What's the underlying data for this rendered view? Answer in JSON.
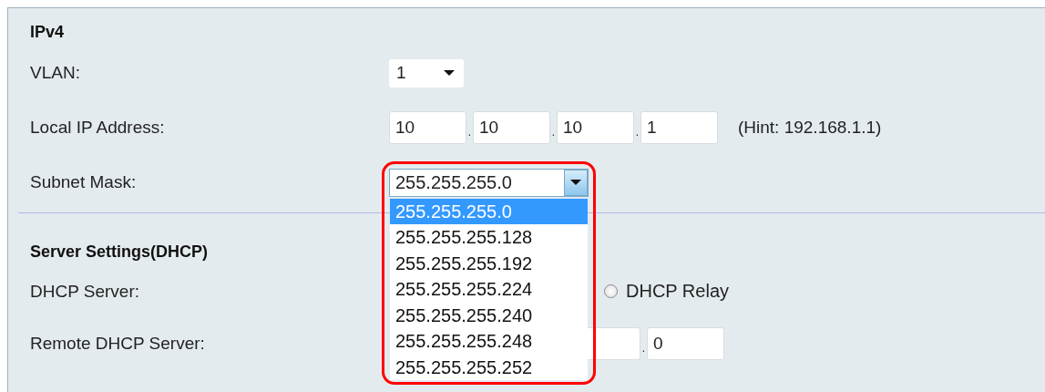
{
  "ipv4": {
    "title": "IPv4",
    "vlan": {
      "label": "VLAN:",
      "value": "1"
    },
    "local_ip": {
      "label": "Local IP Address:",
      "octets": [
        "10",
        "10",
        "10",
        "1"
      ],
      "separators": [
        ".",
        ".",
        "."
      ],
      "hint": "(Hint: 192.168.1.1)"
    },
    "subnet_mask": {
      "label": "Subnet Mask:",
      "value": "255.255.255.0",
      "expanded": true,
      "options": [
        {
          "label": "255.255.255.0",
          "selected": true
        },
        {
          "label": "255.255.255.128",
          "selected": false
        },
        {
          "label": "255.255.255.192",
          "selected": false
        },
        {
          "label": "255.255.255.224",
          "selected": false
        },
        {
          "label": "255.255.255.240",
          "selected": false
        },
        {
          "label": "255.255.255.248",
          "selected": false
        },
        {
          "label": "255.255.255.252",
          "selected": false
        }
      ]
    }
  },
  "server_settings": {
    "title": "Server Settings(DHCP)",
    "dhcp_server": {
      "label": "DHCP Server:",
      "options": [
        {
          "label": "DHCP Relay",
          "selected": false
        }
      ]
    },
    "remote_dhcp_server": {
      "label": "Remote DHCP Server:",
      "separator": ".",
      "last_octet": "0"
    }
  }
}
